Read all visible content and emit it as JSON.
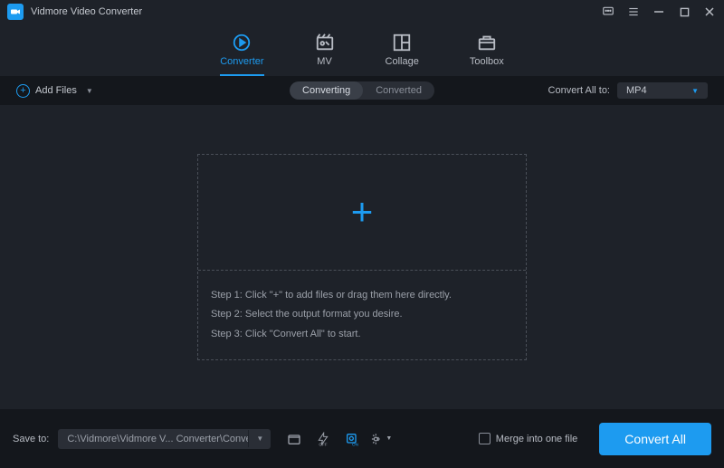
{
  "app": {
    "title": "Vidmore Video Converter"
  },
  "nav": {
    "tabs": [
      {
        "label": "Converter",
        "active": true
      },
      {
        "label": "MV",
        "active": false
      },
      {
        "label": "Collage",
        "active": false
      },
      {
        "label": "Toolbox",
        "active": false
      }
    ]
  },
  "toolbar": {
    "add_files_label": "Add Files",
    "segmented": {
      "converting": "Converting",
      "converted": "Converted",
      "active": "converting"
    },
    "convert_all_to_label": "Convert All to:",
    "format_value": "MP4"
  },
  "dropzone": {
    "steps": [
      "Step 1: Click \"+\" to add files or drag them here directly.",
      "Step 2: Select the output format you desire.",
      "Step 3: Click \"Convert All\" to start."
    ]
  },
  "footer": {
    "save_to_label": "Save to:",
    "save_path": "C:\\Vidmore\\Vidmore V... Converter\\Converted",
    "merge_label": "Merge into one file",
    "convert_all_button": "Convert All"
  },
  "colors": {
    "accent": "#1d9bf0",
    "bg": "#1e2229",
    "panel": "#14171c"
  }
}
